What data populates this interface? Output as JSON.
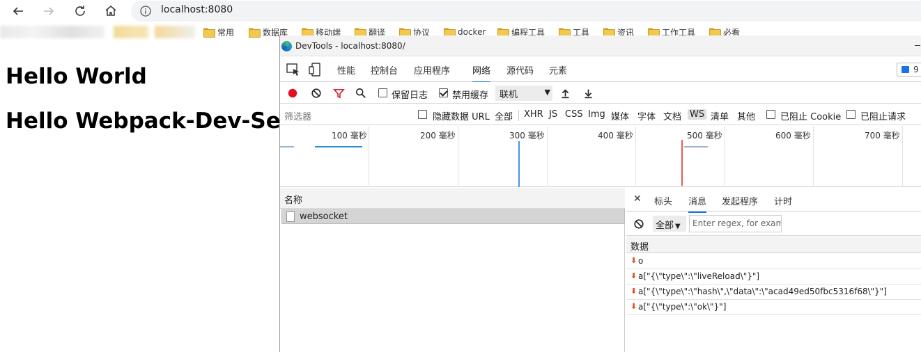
{
  "browser": {
    "url": "localhost:8080",
    "bookmarks": [
      "常用",
      "数据库",
      "移动端",
      "翻译",
      "协议",
      "docker",
      "编程工具",
      "工具",
      "资讯",
      "工作工具",
      "必看"
    ]
  },
  "page": {
    "heading1": "Hello World",
    "heading2": "Hello Webpack-Dev-Server"
  },
  "devtools": {
    "window_title": "DevTools - localhost:8080/",
    "tabs": [
      "性能",
      "控制台",
      "应用程序",
      "网络",
      "源代码",
      "元素"
    ],
    "active_tab": "网络",
    "issues_count": "9",
    "toolbar": {
      "preserve_log": "保留日志",
      "disable_cache": "禁用缓存",
      "throttle": "联机"
    },
    "filter": {
      "placeholder": "筛选器",
      "hide_data_urls": "隐藏数据 URL",
      "types": [
        "全部",
        "XHR",
        "JS",
        "CSS",
        "Img",
        "媒体",
        "字体",
        "文档",
        "WS",
        "清单",
        "其他"
      ],
      "active_type": "WS",
      "blocked_cookies": "已阻止 Cookie",
      "blocked_requests": "已阻止请求"
    },
    "overview_ticks": [
      "100 毫秒",
      "200 毫秒",
      "300 毫秒",
      "400 毫秒",
      "500 毫秒",
      "600 毫秒",
      "700 毫秒"
    ],
    "requests": {
      "column": "名称",
      "rows": [
        "websocket"
      ]
    },
    "detail": {
      "tabs": [
        "标头",
        "消息",
        "发起程序",
        "计时"
      ],
      "active_tab": "消息",
      "filter_select": "全部",
      "search_placeholder": "Enter regex, for exam",
      "data_column": "数据",
      "messages": [
        "o",
        "a[\"{\\\"type\\\":\\\"liveReload\\\"}\"]",
        "a[\"{\\\"type\\\":\\\"hash\\\",\\\"data\\\":\\\"acad49ed50fbc5316f68\\\"}\"]",
        "a[\"{\\\"type\\\":\\\"ok\\\"}\"]"
      ]
    }
  },
  "colors": {
    "accent": "#1a73e8",
    "record": "#e3101f",
    "filter_funnel": "#d9262c",
    "received_arrow": "#e5502a",
    "dom_content_loaded": "#1a73e8",
    "load_event": "#e0403a"
  }
}
